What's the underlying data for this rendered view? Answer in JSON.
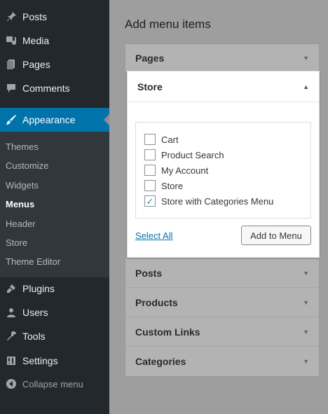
{
  "sidebar": {
    "items_top": [
      {
        "label": "Posts",
        "icon": "pin-icon"
      },
      {
        "label": "Media",
        "icon": "media-icon"
      },
      {
        "label": "Pages",
        "icon": "pages-icon"
      },
      {
        "label": "Comments",
        "icon": "comment-icon"
      }
    ],
    "appearance": {
      "label": "Appearance",
      "icon": "paintbrush-icon"
    },
    "submenu": [
      "Themes",
      "Customize",
      "Widgets",
      "Menus",
      "Header",
      "Store",
      "Theme Editor"
    ],
    "submenu_current": "Menus",
    "items_bottom": [
      {
        "label": "Plugins",
        "icon": "plugin-icon"
      },
      {
        "label": "Users",
        "icon": "users-icon"
      },
      {
        "label": "Tools",
        "icon": "wrench-icon"
      },
      {
        "label": "Settings",
        "icon": "settings-icon"
      }
    ],
    "collapse_label": "Collapse menu"
  },
  "main": {
    "title": "Add menu items",
    "pages_label": "Pages",
    "store": {
      "label": "Store",
      "options": [
        {
          "label": "Cart",
          "checked": false
        },
        {
          "label": "Product Search",
          "checked": false
        },
        {
          "label": "My Account",
          "checked": false
        },
        {
          "label": "Store",
          "checked": false
        },
        {
          "label": "Store with Categories Menu",
          "checked": true
        }
      ],
      "select_all": "Select All",
      "add_button": "Add to Menu"
    },
    "sections_below": [
      "Posts",
      "Products",
      "Custom Links",
      "Categories"
    ]
  },
  "colors": {
    "sidebar_bg": "#23282d",
    "active_bg": "#0073aa",
    "link": "#0073aa"
  }
}
